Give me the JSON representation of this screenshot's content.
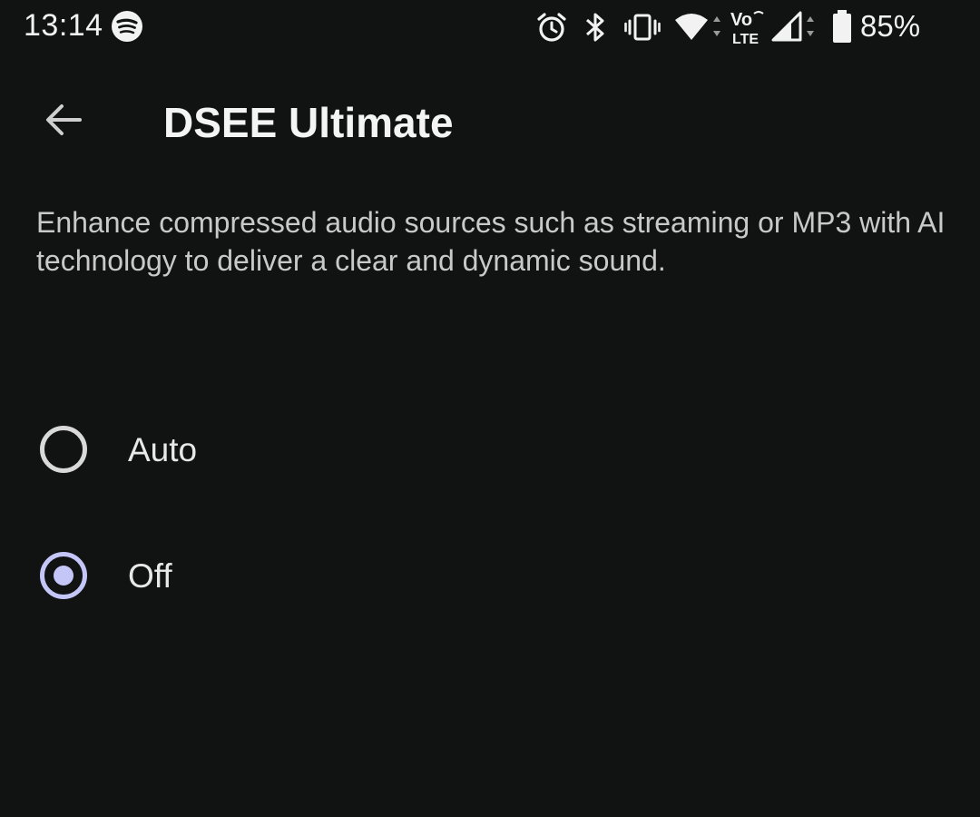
{
  "status_bar": {
    "time": "13:14",
    "battery_percent": "85%",
    "network_label": "LTE",
    "icons": [
      "spotify-icon",
      "alarm-icon",
      "bluetooth-icon",
      "vibrate-icon",
      "wifi-icon",
      "volte-icon",
      "cell-signal-icon",
      "battery-icon"
    ]
  },
  "app_bar": {
    "title": "DSEE Ultimate",
    "back_icon": "arrow-left-icon"
  },
  "description": "Enhance compressed audio sources such as streaming or MP3 with AI technology to deliver a clear and dynamic sound.",
  "options": [
    {
      "label": "Auto",
      "selected": false
    },
    {
      "label": "Off",
      "selected": true
    }
  ],
  "colors": {
    "background": "#111212",
    "accent": "#c5c6f8",
    "text_primary": "#f4f4f4",
    "text_secondary": "#c9c9c9"
  }
}
